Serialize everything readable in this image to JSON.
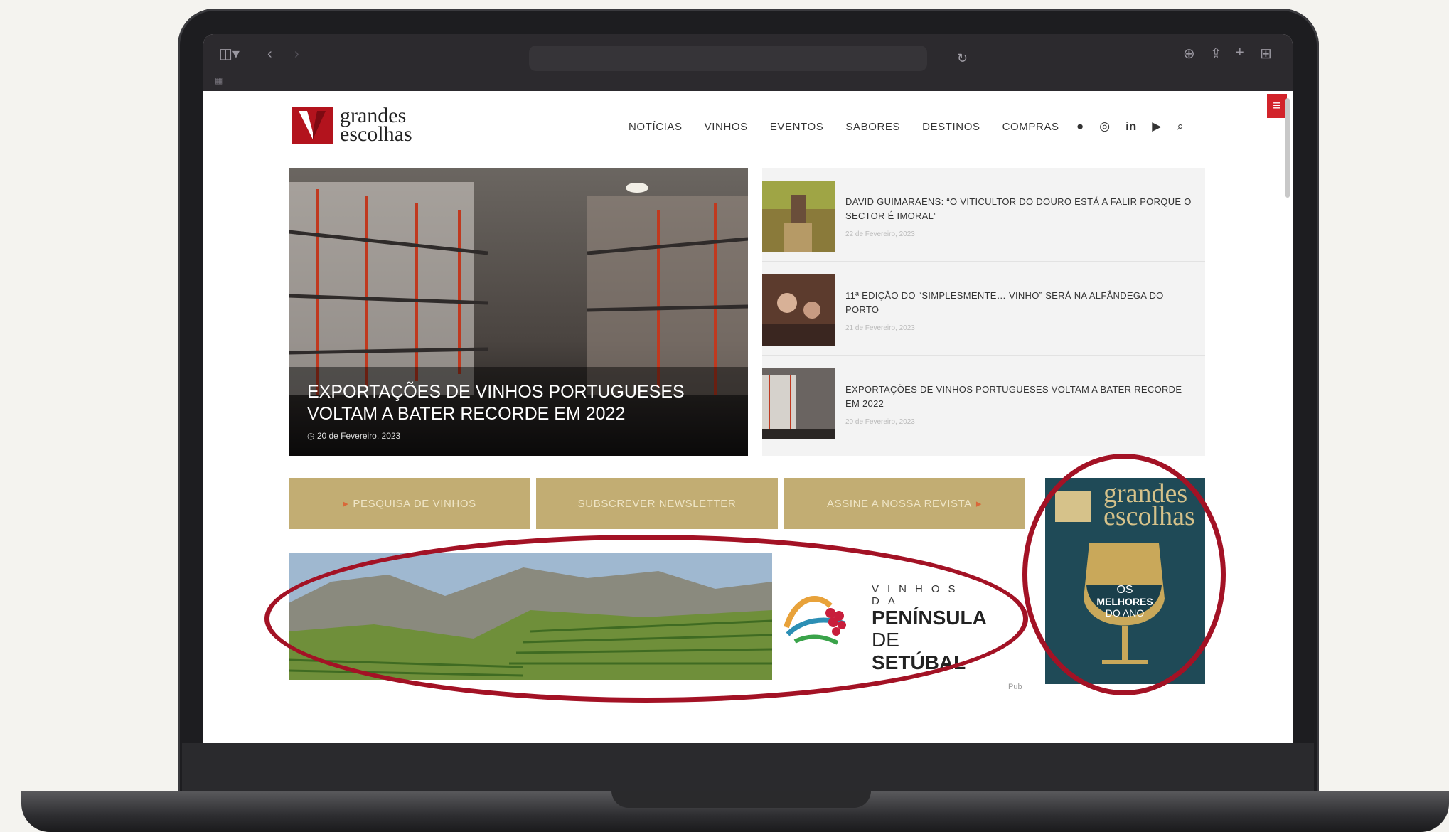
{
  "logo": {
    "line1": "grandes",
    "line2": "escolhas"
  },
  "nav": [
    "NOTÍCIAS",
    "VINHOS",
    "EVENTOS",
    "SABORES",
    "DESTINOS",
    "COMPRAS"
  ],
  "hero": {
    "title": "EXPORTAÇÕES DE VINHOS PORTUGUESES VOLTAM A BATER RECORDE EM 2022",
    "date": "20 de Fevereiro, 2023"
  },
  "news": [
    {
      "title": "DAVID GUIMARAENS: “O VITICULTOR DO DOURO ESTÁ A FALIR PORQUE O SECTOR É IMORAL”",
      "date": "22 de Fevereiro, 2023"
    },
    {
      "title": "11ª EDIÇÃO DO “SIMPLESMENTE… VINHO” SERÁ NA ALFÂNDEGA DO PORTO",
      "date": "21 de Fevereiro, 2023"
    },
    {
      "title": "EXPORTAÇÕES DE VINHOS PORTUGUESES VOLTAM A BATER RECORDE EM 2022",
      "date": "20 de Fevereiro, 2023"
    }
  ],
  "cta": {
    "search": "PESQUISA DE VINHOS",
    "newsletter": "SUBSCREVER NEWSLETTER",
    "subscribe": "ASSINE A NOSSA REVISTA"
  },
  "ad": {
    "line1": "VINHOS DA",
    "line2": "PENÍNSULA",
    "line3a": "DE ",
    "line3b": "SETÚBAL",
    "pub": "Pub"
  },
  "magazine": {
    "title1": "grandes",
    "title2": "escolhas",
    "badge1": "OS",
    "badge2": "MELHORES",
    "badge3": "DO ANO"
  },
  "colors": {
    "brand_red": "#b3131d",
    "gold": "#c2ad73",
    "highlight_circle": "#a31225"
  }
}
